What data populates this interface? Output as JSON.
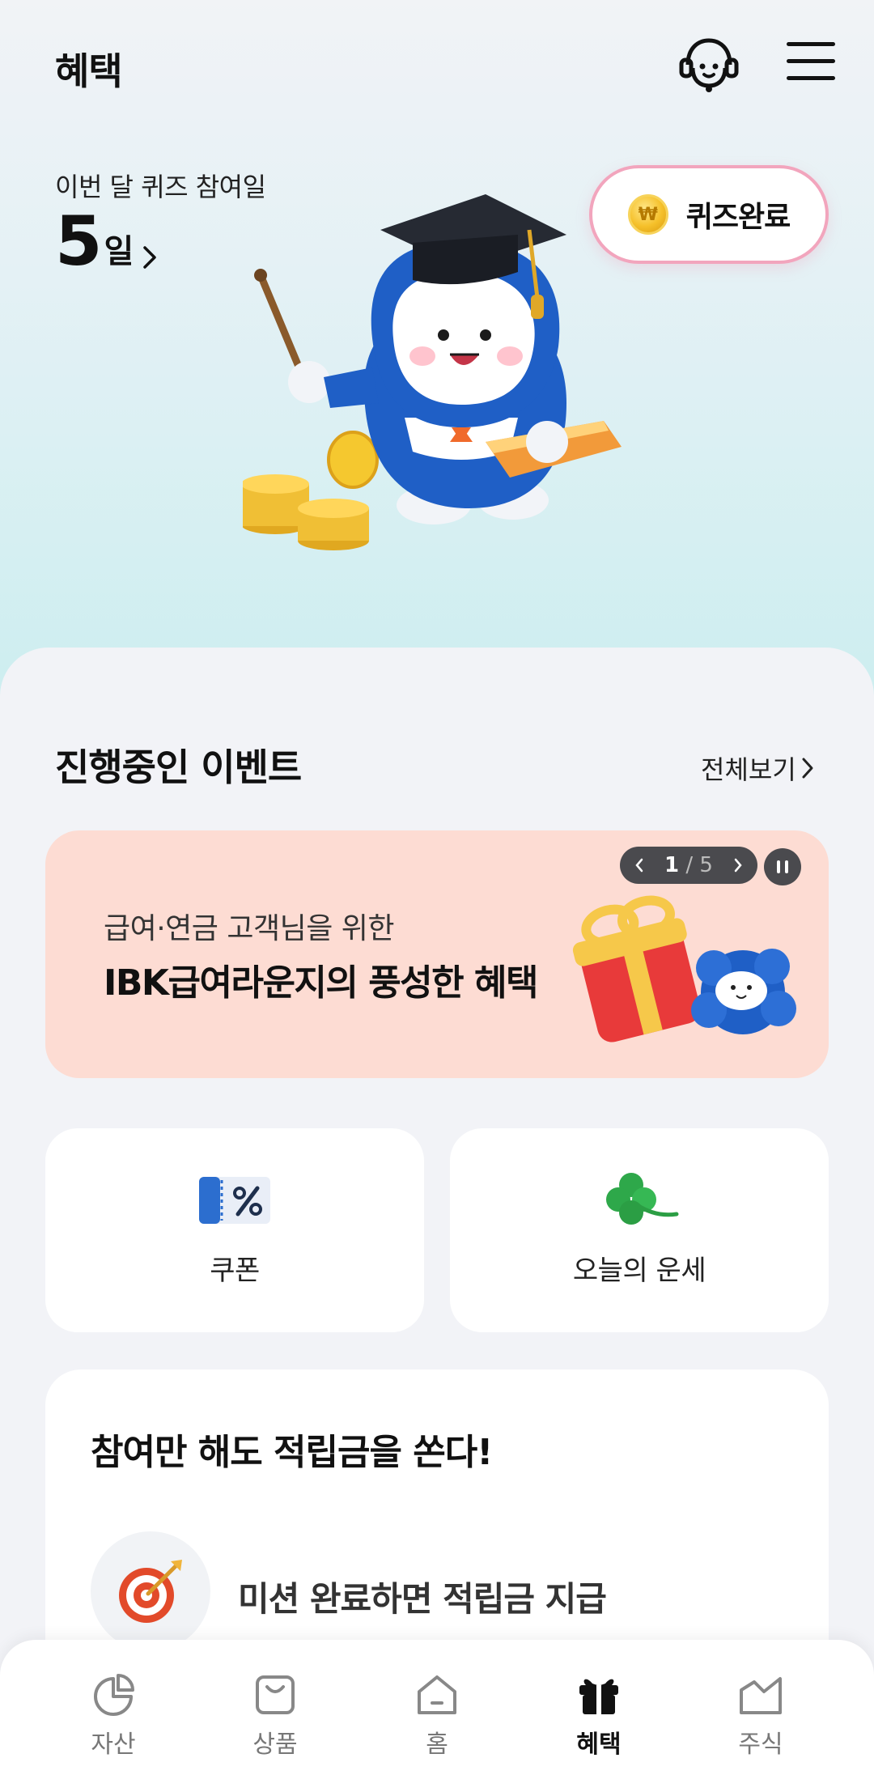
{
  "header": {
    "title": "혜택"
  },
  "quiz": {
    "label": "이번 달 퀴즈 참여일",
    "count": "5",
    "unit": "일",
    "coin_symbol": "₩",
    "status_button": "퀴즈완료"
  },
  "events": {
    "title": "진행중인 이벤트",
    "see_all": "전체보기",
    "banner": {
      "subtitle": "급여·연금 고객님을 위한",
      "title": "IBK급여라운지의 풍성한 혜택",
      "page_current": "1",
      "page_separator": "/",
      "page_total": "5",
      "background": "#fddcd3"
    }
  },
  "shortcuts": [
    {
      "label": "쿠폰",
      "icon": "coupon-icon"
    },
    {
      "label": "오늘의 운세",
      "icon": "clover-icon"
    }
  ],
  "mission_card": {
    "title": "참여만 해도 적립금을 쏜다!",
    "mission_text": "미션 완료하면 적립금 지급",
    "icon": "target-icon"
  },
  "tabs": [
    {
      "label": "자산",
      "icon": "asset-chart-icon"
    },
    {
      "label": "상품",
      "icon": "shopping-bag-icon"
    },
    {
      "label": "홈",
      "icon": "home-icon"
    },
    {
      "label": "혜택",
      "icon": "gift-icon",
      "active": true
    },
    {
      "label": "주식",
      "icon": "stock-icon"
    }
  ],
  "colors": {
    "accent_pink": "#f2a5bd",
    "mascot_blue": "#1e5fc4",
    "coin_gold": "#f5c02a"
  }
}
